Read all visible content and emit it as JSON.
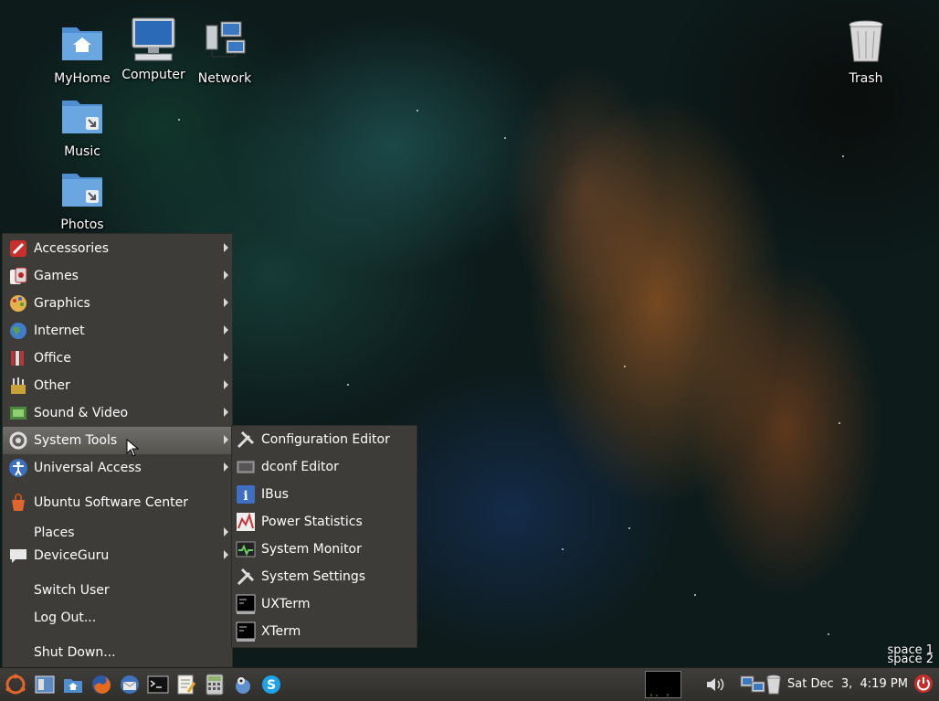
{
  "desktop": {
    "icons": [
      {
        "label": "MyHome",
        "icon": "home-folder-icon"
      },
      {
        "label": "Computer",
        "icon": "computer-icon"
      },
      {
        "label": "Network",
        "icon": "network-icon"
      },
      {
        "label": "Trash",
        "icon": "trash-icon"
      },
      {
        "label": "Music",
        "icon": "folder-link-icon"
      },
      {
        "label": "Photos",
        "icon": "folder-link-icon"
      }
    ]
  },
  "menu": {
    "items": [
      {
        "label": "Accessories",
        "icon": "accessories-icon",
        "submenu": true
      },
      {
        "label": "Games",
        "icon": "games-icon",
        "submenu": true
      },
      {
        "label": "Graphics",
        "icon": "graphics-icon",
        "submenu": true
      },
      {
        "label": "Internet",
        "icon": "internet-icon",
        "submenu": true
      },
      {
        "label": "Office",
        "icon": "office-icon",
        "submenu": true
      },
      {
        "label": "Other",
        "icon": "other-icon",
        "submenu": true
      },
      {
        "label": "Sound & Video",
        "icon": "sound-video-icon",
        "submenu": true
      },
      {
        "label": "System Tools",
        "icon": "system-tools-icon",
        "submenu": true,
        "active": true
      },
      {
        "label": "Universal Access",
        "icon": "universal-access-icon",
        "submenu": true
      },
      {
        "label": "Ubuntu Software Center",
        "icon": "software-center-icon",
        "submenu": false
      },
      {
        "label": "Places",
        "icon": "",
        "submenu": true
      },
      {
        "label": "DeviceGuru",
        "icon": "user-bubble-icon",
        "submenu": true
      },
      {
        "label": "Switch User",
        "icon": "",
        "submenu": false
      },
      {
        "label": "Log Out...",
        "icon": "",
        "submenu": false
      },
      {
        "label": "Shut Down...",
        "icon": "",
        "submenu": false
      }
    ]
  },
  "submenu": {
    "items": [
      {
        "label": "Configuration Editor",
        "icon": "wrench-icon"
      },
      {
        "label": "dconf Editor",
        "icon": "dconf-icon"
      },
      {
        "label": "IBus",
        "icon": "info-icon"
      },
      {
        "label": "Power Statistics",
        "icon": "power-statistics-icon"
      },
      {
        "label": "System Monitor",
        "icon": "system-monitor-icon"
      },
      {
        "label": "System Settings",
        "icon": "wrench-icon"
      },
      {
        "label": "UXTerm",
        "icon": "terminal-icon"
      },
      {
        "label": "XTerm",
        "icon": "terminal-icon"
      }
    ]
  },
  "workspaces": [
    "space 1",
    "space 2"
  ],
  "taskbar": {
    "launchers": [
      "ubuntu-logo-icon",
      "show-desktop-icon",
      "file-manager-icon",
      "firefox-icon",
      "thunderbird-icon",
      "terminal-icon",
      "text-editor-icon",
      "calculator-icon",
      "pidgin-icon",
      "skype-icon"
    ],
    "clock": "Sat Dec  3,  4:19 PM"
  }
}
